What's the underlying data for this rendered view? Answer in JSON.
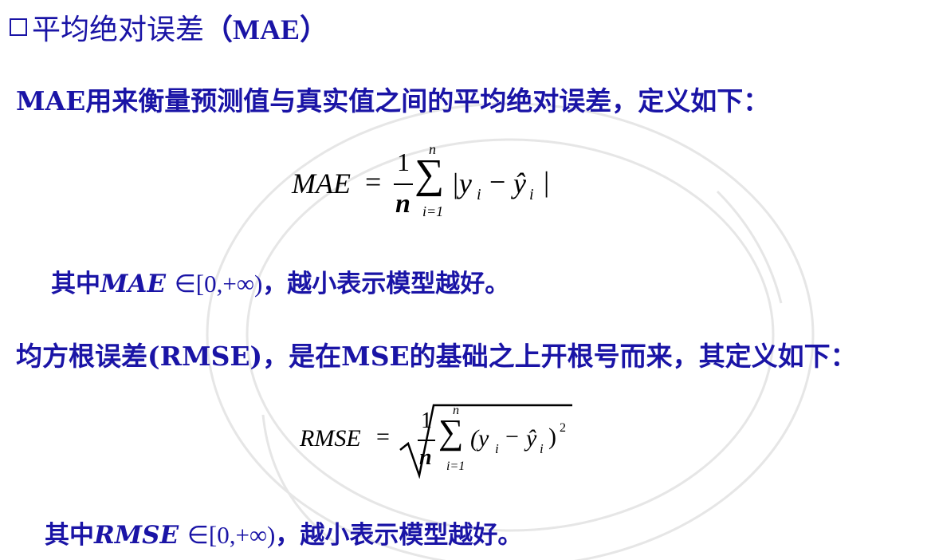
{
  "heading": {
    "checkbox_icon": "checkbox-square-icon",
    "title_cn": "平均绝对误差",
    "title_abbr": "（MAE）"
  },
  "mae": {
    "intro": "MAE用来衡量预测值与真实值之间的平均绝对误差，定义如下：",
    "formula": {
      "lhs": "MAE",
      "equals": "=",
      "frac_num": "1",
      "frac_den": "n",
      "sum_upper": "n",
      "sum_lower": "i=1",
      "sum_symbol": "∑",
      "term": "|y",
      "term_sub": "i",
      "minus": "−",
      "hat": "ŷ",
      "hat_sub": "i",
      "close": "|"
    },
    "note_prefix": "其中",
    "note_var": "MAE",
    "note_range": "∈[0,+∞)",
    "note_suffix": "，越小表示模型越好。"
  },
  "rmse": {
    "intro": "均方根误差(RMSE)，是在MSE的基础之上开根号而来，其定义如下：",
    "formula": {
      "lhs": "RMSE",
      "equals": "=",
      "frac_num": "1",
      "frac_den": "n",
      "sum_upper": "n",
      "sum_lower": "i=1",
      "sum_symbol": "∑",
      "open": "(y",
      "term_sub": "i",
      "minus": "−",
      "hat": "ŷ",
      "hat_sub": "i",
      "close": ")",
      "power": "2"
    },
    "note_prefix": "其中",
    "note_var": "RMSE",
    "note_range": "∈[0,+∞)",
    "note_suffix": "，越小表示模型越好。"
  },
  "colors": {
    "text_blue": "#1a14a6",
    "formula": "#000000",
    "watermark": "#e6e6e6"
  }
}
